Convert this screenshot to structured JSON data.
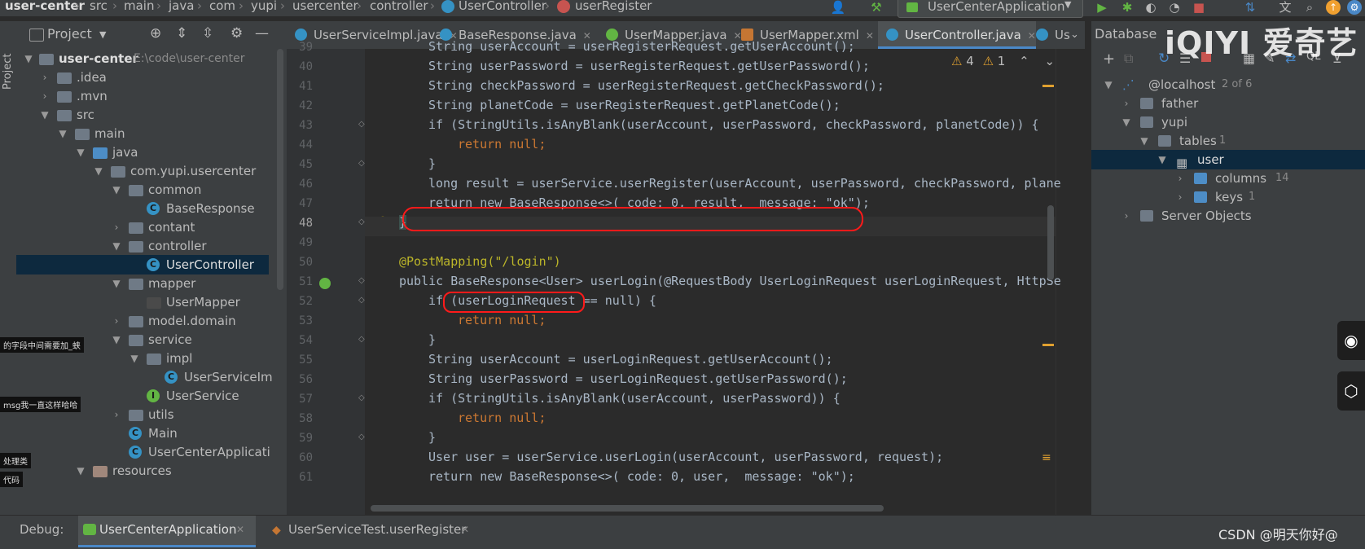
{
  "breadcrumb": [
    "user-center",
    "src",
    "main",
    "java",
    "com",
    "yupi",
    "usercenter",
    "controller",
    "UserController",
    "userRegister"
  ],
  "run_config": "UserCenterApplication",
  "project_panel": {
    "title": "Project",
    "tree": [
      {
        "label": "user-center",
        "note": "E:\\code\\user-center"
      },
      {
        "label": ".idea"
      },
      {
        "label": ".mvn"
      },
      {
        "label": "src"
      },
      {
        "label": "main"
      },
      {
        "label": "java"
      },
      {
        "label": "com.yupi.usercenter"
      },
      {
        "label": "common"
      },
      {
        "label": "BaseResponse"
      },
      {
        "label": "contant"
      },
      {
        "label": "controller"
      },
      {
        "label": "UserController"
      },
      {
        "label": "mapper"
      },
      {
        "label": "UserMapper"
      },
      {
        "label": "model.domain"
      },
      {
        "label": "service"
      },
      {
        "label": "impl"
      },
      {
        "label": "UserServiceIm"
      },
      {
        "label": "UserService"
      },
      {
        "label": "utils"
      },
      {
        "label": "Main"
      },
      {
        "label": "UserCenterApplicati"
      },
      {
        "label": "resources"
      }
    ],
    "overlay_notes": [
      "的字段中间需要加_蛱",
      "msg我一直这样哈哈",
      "处理类",
      "代码"
    ]
  },
  "tabs": [
    {
      "label": "UserServiceImpl.java"
    },
    {
      "label": "BaseResponse.java"
    },
    {
      "label": "UserMapper.java"
    },
    {
      "label": "UserMapper.xml"
    },
    {
      "label": "UserController.java"
    },
    {
      "label": "Us"
    }
  ],
  "inspection": {
    "warnings": "4",
    "weak_warnings": "1"
  },
  "editor": {
    "line_numbers": [
      "39",
      "40",
      "41",
      "42",
      "43",
      "44",
      "45",
      "46",
      "47",
      "48",
      "49",
      "50",
      "51",
      "52",
      "53",
      "54",
      "55",
      "56",
      "57",
      "58",
      "59",
      "60",
      "61"
    ],
    "lines": [
      "String userAccount = userRegisterRequest.getUserAccount();",
      "String userPassword = userRegisterRequest.getUserPassword();",
      "String checkPassword = userRegisterRequest.getCheckPassword();",
      "String planetCode = userRegisterRequest.getPlanetCode();",
      "if (StringUtils.isAnyBlank(userAccount, userPassword, checkPassword, planetCode)) {",
      "return null;",
      "}",
      "long result = userService.userRegister(userAccount, userPassword, checkPassword, plane",
      "return new BaseResponse<>( code: 0, result,  message: \"ok\");",
      "}",
      "",
      "@PostMapping(\"/login\")",
      "public BaseResponse<User> userLogin(@RequestBody UserLoginRequest userLoginRequest, HttpSe",
      "if (userLoginRequest == null) {",
      "return null;",
      "}",
      "String userAccount = userLoginRequest.getUserAccount();",
      "String userPassword = userLoginRequest.getUserPassword();",
      "if (StringUtils.isAnyBlank(userAccount, userPassword)) {",
      "return null;",
      "}",
      "User user = userService.userLogin(userAccount, userPassword, request);",
      "return new BaseResponse<>( code: 0, user,  message: \"ok\");"
    ]
  },
  "database_panel": {
    "title": "Database",
    "tree": [
      {
        "label": "@localhost",
        "note": "2 of 6"
      },
      {
        "label": "father"
      },
      {
        "label": "yupi"
      },
      {
        "label": "tables",
        "note": "1"
      },
      {
        "label": "user"
      },
      {
        "label": "columns",
        "note": "14"
      },
      {
        "label": "keys",
        "note": "1"
      },
      {
        "label": "Server Objects"
      }
    ]
  },
  "debug_bar": {
    "label": "Debug:",
    "tabs": [
      "UserCenterApplication",
      "UserServiceTest.userRegister"
    ]
  },
  "watermarks": {
    "iqiyi": "iQIYI 爱奇艺",
    "csdn": "CSDN @明天你好@"
  }
}
